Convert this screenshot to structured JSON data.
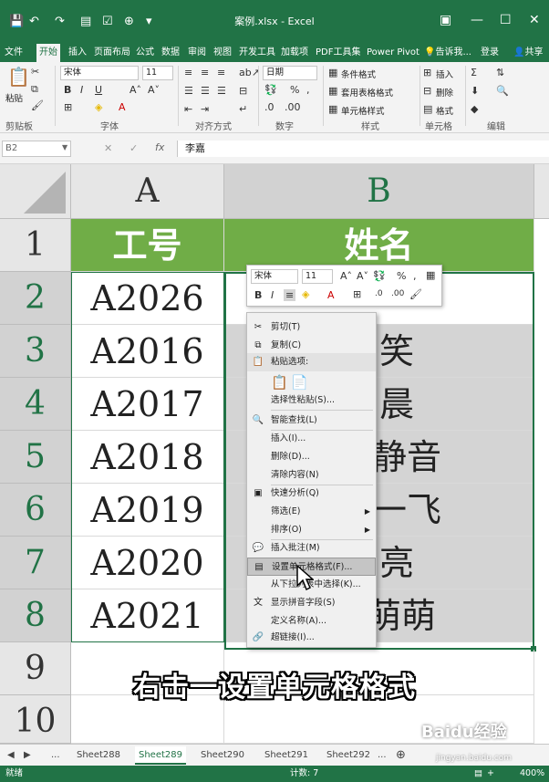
{
  "window": {
    "title": "案例.xlsx - Excel"
  },
  "tabs": [
    "文件",
    "开始",
    "插入",
    "页面布局",
    "公式",
    "数据",
    "审阅",
    "视图",
    "开发工具",
    "加载项",
    "PDF工具集",
    "Power Pivot",
    "告诉我...",
    "登录",
    "共享"
  ],
  "ribbon": {
    "paste_label": "粘贴",
    "font_name": "宋体",
    "font_size": "11",
    "number_format": "日期",
    "styles": [
      "条件格式",
      "套用表格格式",
      "单元格样式"
    ],
    "cells_items": [
      "插入",
      "删除",
      "格式"
    ],
    "groups": [
      "剪贴板",
      "字体",
      "对齐方式",
      "数字",
      "样式",
      "单元格",
      "编辑"
    ]
  },
  "formula_bar": {
    "name_box": "B2",
    "fx": "fx",
    "value": "李嘉"
  },
  "sheet": {
    "columns": [
      "A",
      "B"
    ],
    "rows": [
      "1",
      "2",
      "3",
      "4",
      "5",
      "6",
      "7",
      "8",
      "9",
      "10"
    ],
    "header_row": [
      "工号",
      "姓名"
    ],
    "col_a": [
      "A2026",
      "A2016",
      "A2017",
      "A2018",
      "A2019",
      "A2020",
      "A2021"
    ],
    "col_b_visible": [
      "李嘉",
      "笑",
      "晨",
      "静音",
      "一飞",
      "亮",
      "萌萌"
    ]
  },
  "mini_toolbar": {
    "font_name": "宋体",
    "font_size": "11"
  },
  "context_menu": [
    {
      "label": "剪切(T)",
      "icon": "scissors-icon"
    },
    {
      "label": "复制(C)",
      "icon": "copy-icon"
    },
    {
      "label": "粘贴选项:",
      "icon": "paste-icon"
    },
    {
      "label": "",
      "icon": "paste-option-icons"
    },
    {
      "label": "选择性粘贴(S)...",
      "icon": ""
    },
    {
      "label": "智能查找(L)",
      "icon": "search-icon"
    },
    {
      "label": "插入(I)...",
      "icon": ""
    },
    {
      "label": "删除(D)...",
      "icon": ""
    },
    {
      "label": "清除内容(N)",
      "icon": ""
    },
    {
      "label": "快速分析(Q)",
      "icon": "quick-analysis-icon"
    },
    {
      "label": "筛选(E)",
      "icon": ""
    },
    {
      "label": "排序(O)",
      "icon": ""
    },
    {
      "label": "插入批注(M)",
      "icon": "comment-icon"
    },
    {
      "label": "设置单元格格式(F)...",
      "icon": "format-cells-icon"
    },
    {
      "label": "从下拉列表中选择(K)...",
      "icon": ""
    },
    {
      "label": "显示拼音字段(S)",
      "icon": "pinyin-icon"
    },
    {
      "label": "定义名称(A)...",
      "icon": ""
    },
    {
      "label": "超链接(I)...",
      "icon": "link-icon"
    }
  ],
  "sheet_tabs": [
    "Sheet288",
    "Sheet289",
    "Sheet290",
    "Sheet291",
    "Sheet292"
  ],
  "status": {
    "left": "就绪",
    "count": "计数: 7",
    "zoom": "400%"
  },
  "caption": "右击一设置单元格格式",
  "watermark": {
    "brand": "Baidu经验",
    "url": "jingyan.baidu.com"
  }
}
